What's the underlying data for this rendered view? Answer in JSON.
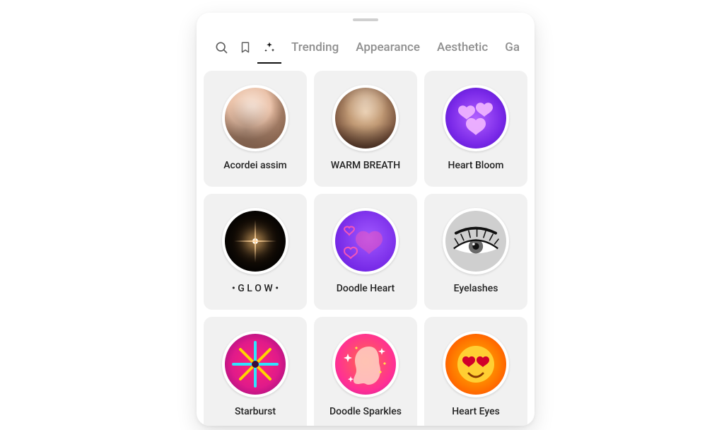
{
  "tabs": {
    "items": [
      {
        "label": "Trending"
      },
      {
        "label": "Appearance"
      },
      {
        "label": "Aesthetic"
      },
      {
        "label": "Ga"
      }
    ]
  },
  "effects": [
    {
      "name": "Acordei assim",
      "icon": "face-photo-1"
    },
    {
      "name": "WARM BREATH",
      "icon": "face-photo-2"
    },
    {
      "name": "Heart Bloom",
      "icon": "purple-hearts"
    },
    {
      "name": "• G L O W •",
      "icon": "black-lens-flare"
    },
    {
      "name": "Doodle Heart",
      "icon": "purple-doodle-heart"
    },
    {
      "name": "Eyelashes",
      "icon": "eye-lash"
    },
    {
      "name": "Starburst",
      "icon": "pink-starburst"
    },
    {
      "name": "Doodle Sparkles",
      "icon": "head-sparkles"
    },
    {
      "name": "Heart Eyes",
      "icon": "heart-eyes-emoji"
    }
  ],
  "colors": {
    "text_muted": "#8f8f8f",
    "text": "#222222",
    "tile_bg": "#f1f1f1"
  }
}
